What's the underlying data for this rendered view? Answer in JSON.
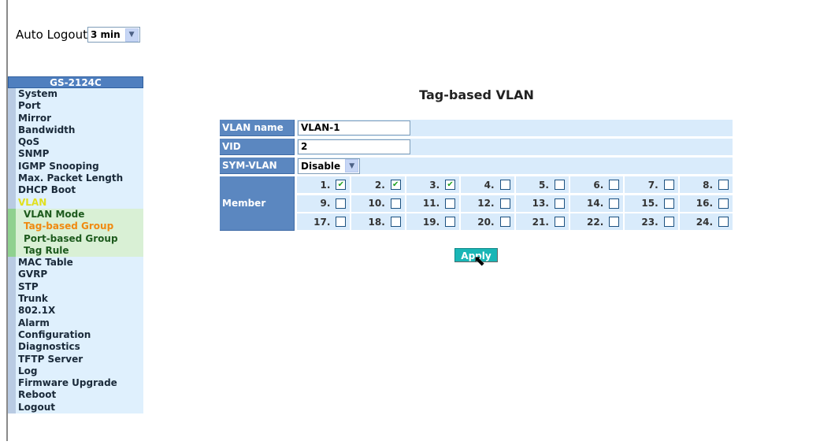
{
  "header": {
    "auto_logout_label": "Auto Logout",
    "auto_logout_value": "3 min"
  },
  "sidebar": {
    "title": "GS-2124C",
    "items": [
      {
        "label": "System"
      },
      {
        "label": "Port"
      },
      {
        "label": "Mirror"
      },
      {
        "label": "Bandwidth"
      },
      {
        "label": "QoS"
      },
      {
        "label": "SNMP"
      },
      {
        "label": "IGMP Snooping"
      },
      {
        "label": "Max. Packet Length"
      },
      {
        "label": "DHCP Boot"
      },
      {
        "label": "VLAN"
      },
      {
        "label": "VLAN Mode"
      },
      {
        "label": "Tag-based Group"
      },
      {
        "label": "Port-based Group"
      },
      {
        "label": "Tag Rule"
      },
      {
        "label": "MAC Table"
      },
      {
        "label": "GVRP"
      },
      {
        "label": "STP"
      },
      {
        "label": "Trunk"
      },
      {
        "label": "802.1X"
      },
      {
        "label": "Alarm"
      },
      {
        "label": "Configuration"
      },
      {
        "label": "Diagnostics"
      },
      {
        "label": "TFTP Server"
      },
      {
        "label": "Log"
      },
      {
        "label": "Firmware Upgrade"
      },
      {
        "label": "Reboot"
      },
      {
        "label": "Logout"
      }
    ],
    "active": "Tag-based Group"
  },
  "main": {
    "title": "Tag-based VLAN",
    "vlan_name_label": "VLAN name",
    "vlan_name": "VLAN-1",
    "vid_label": "VID",
    "vid": "2",
    "sym_label": "SYM-VLAN",
    "sym_value": "Disable",
    "member_label": "Member",
    "members": [
      1,
      2,
      3,
      4,
      5,
      6,
      7,
      8,
      9,
      10,
      11,
      12,
      13,
      14,
      15,
      16,
      17,
      18,
      19,
      20,
      21,
      22,
      23,
      24
    ],
    "checked": [
      1,
      2,
      3
    ],
    "apply_label": "Apply"
  }
}
